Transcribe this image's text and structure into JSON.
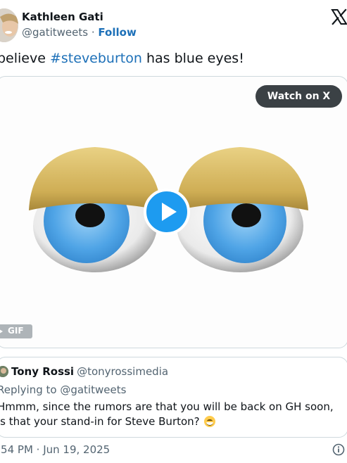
{
  "author": {
    "name": "Kathleen Gati",
    "handle": "@gatitweets",
    "separator": "·",
    "follow_label": "Follow"
  },
  "tweet": {
    "text_before": "believe ",
    "hashtag": "#steveburton",
    "text_after": " has blue eyes!"
  },
  "media": {
    "watch_label": "Watch on X",
    "gif_badge": "GIF"
  },
  "quoted_reply": {
    "name": "Tony Rossi",
    "handle": "@tonyrossimedia",
    "replying_to": "Replying to @gatitweets",
    "line1": "Hmmm, since the rumors are that you will be back on GH soon,",
    "line2": "is that your stand-in for Steve Burton?"
  },
  "footer": {
    "timestamp": ":54 PM · Jun 19, 2025"
  },
  "colors": {
    "link": "#1d70b8",
    "muted": "#536471",
    "eye_iris": "#55a9e8",
    "eyelid": "#d1b25a"
  },
  "icons": [
    "x-logo-icon",
    "play-icon",
    "info-icon",
    "grin-emoji-icon"
  ]
}
